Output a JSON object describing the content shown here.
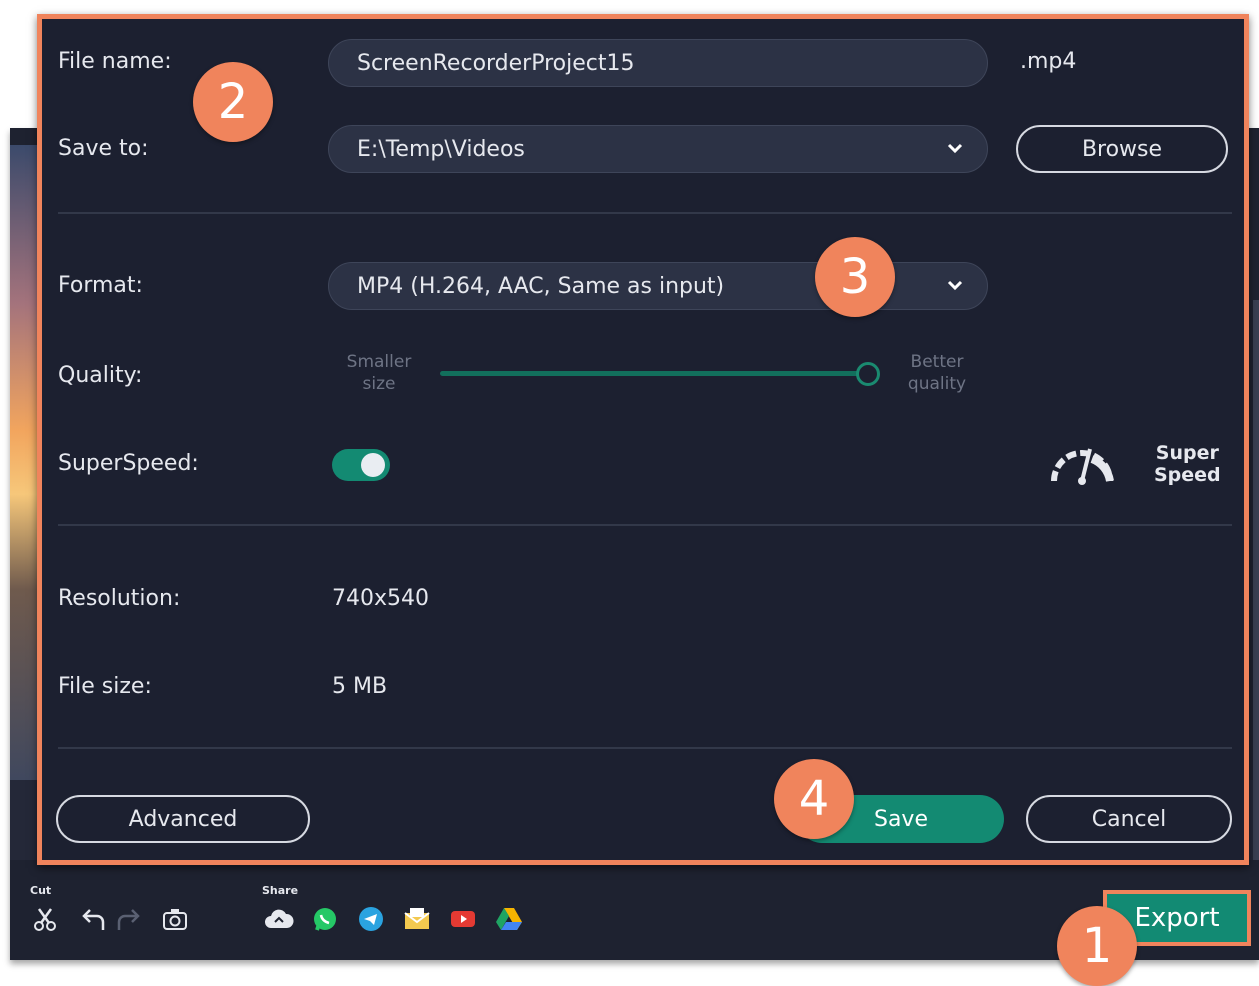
{
  "dialog": {
    "file_name": {
      "label": "File name:",
      "value": "ScreenRecorderProject15",
      "extension": ".mp4"
    },
    "save_to": {
      "label": "Save to:",
      "value": "E:\\Temp\\Videos",
      "browse_label": "Browse"
    },
    "format": {
      "label": "Format:",
      "value": "MP4 (H.264, AAC, Same as input)"
    },
    "quality": {
      "label": "Quality:",
      "min_hint_line1": "Smaller",
      "min_hint_line2": "size",
      "max_hint_line1": "Better",
      "max_hint_line2": "quality",
      "level": 1.0
    },
    "superspeed": {
      "label": "SuperSpeed:",
      "enabled": true,
      "badge_line1": "Super",
      "badge_line2": "Speed",
      "icon": "speedometer-icon"
    },
    "resolution": {
      "label": "Resolution:",
      "value": "740x540"
    },
    "file_size": {
      "label": "File size:",
      "value": "5 MB"
    },
    "buttons": {
      "advanced": "Advanced",
      "save": "Save",
      "cancel": "Cancel"
    }
  },
  "toolbar": {
    "cut_label": "Cut",
    "share_label": "Share",
    "export_label": "Export",
    "edit_icons": [
      "scissors-icon",
      "undo-icon",
      "redo-icon",
      "snapshot-icon"
    ],
    "share_icons": [
      "cloud-upload-icon",
      "whatsapp-icon",
      "telegram-icon",
      "email-icon",
      "youtube-icon",
      "google-drive-icon"
    ]
  },
  "markers": {
    "m1": "1",
    "m2": "2",
    "m3": "3",
    "m4": "4"
  },
  "colors": {
    "accent": "#138a72",
    "highlight": "#f0845c",
    "dialog_bg": "#1c2030"
  }
}
